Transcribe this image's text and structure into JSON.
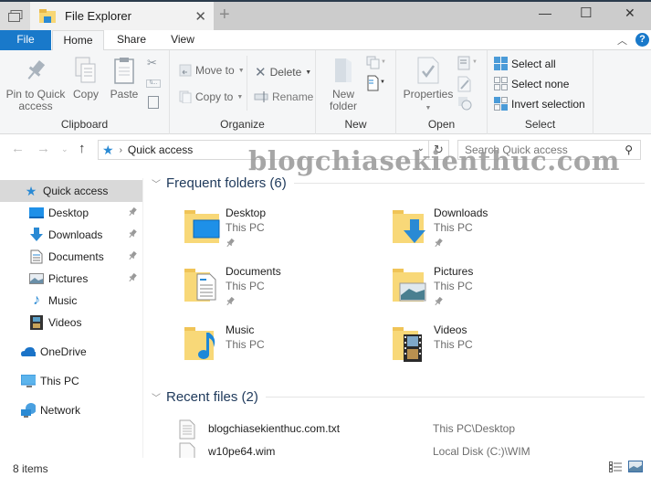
{
  "window": {
    "tab_title": "File Explorer",
    "new_tab_symbol": "+",
    "controls": {
      "minimize": "—",
      "maximize": "☐",
      "close": "✕"
    }
  },
  "ribbon_tabs": [
    {
      "label": "File",
      "active": false
    },
    {
      "label": "Home",
      "active": true
    },
    {
      "label": "Share",
      "active": false
    },
    {
      "label": "View",
      "active": false
    }
  ],
  "ribbon": {
    "help": "?",
    "collapse": "^",
    "groups": {
      "clipboard": {
        "label": "Clipboard",
        "pin_line1": "Pin to Quick",
        "pin_line2": "access",
        "copy": "Copy",
        "paste": "Paste"
      },
      "organize": {
        "label": "Organize",
        "move_to": "Move to",
        "copy_to": "Copy to",
        "delete": "Delete",
        "rename": "Rename"
      },
      "new": {
        "label": "New",
        "new_folder_line1": "New",
        "new_folder_line2": "folder"
      },
      "open": {
        "label": "Open",
        "properties": "Properties"
      },
      "select": {
        "label": "Select",
        "select_all": "Select all",
        "select_none": "Select none",
        "invert_selection": "Invert selection"
      }
    }
  },
  "address_bar": {
    "location": "Quick access",
    "search_placeholder": "Search Quick access"
  },
  "nav_pane": {
    "quick_access": "Quick access",
    "pinned": [
      {
        "label": "Desktop",
        "pinned": true
      },
      {
        "label": "Downloads",
        "pinned": true
      },
      {
        "label": "Documents",
        "pinned": true
      },
      {
        "label": "Pictures",
        "pinned": true
      },
      {
        "label": "Music",
        "pinned": false
      },
      {
        "label": "Videos",
        "pinned": false
      }
    ],
    "onedrive": "OneDrive",
    "this_pc": "This PC",
    "network": "Network"
  },
  "content": {
    "frequent_header": "Frequent folders (6)",
    "folders": [
      {
        "name": "Desktop",
        "location": "This PC",
        "pinned": true
      },
      {
        "name": "Downloads",
        "location": "This PC",
        "pinned": true
      },
      {
        "name": "Documents",
        "location": "This PC",
        "pinned": true
      },
      {
        "name": "Pictures",
        "location": "This PC",
        "pinned": true
      },
      {
        "name": "Music",
        "location": "This PC",
        "pinned": false
      },
      {
        "name": "Videos",
        "location": "This PC",
        "pinned": false
      }
    ],
    "recent_header": "Recent files (2)",
    "recent_files": [
      {
        "name": "blogchiasekienthuc.com.txt",
        "location": "This PC\\Desktop"
      },
      {
        "name": "w10pe64.wim",
        "location": "Local Disk (C:)\\WIM"
      }
    ]
  },
  "status_bar": {
    "item_count": "8 items"
  },
  "watermark": "blogchiasekienthuc.com",
  "colors": {
    "accent": "#1979ca",
    "header_text": "#1e395b",
    "folder_yellow": "#f5d37c",
    "selected_bg": "#d9d9d9"
  }
}
